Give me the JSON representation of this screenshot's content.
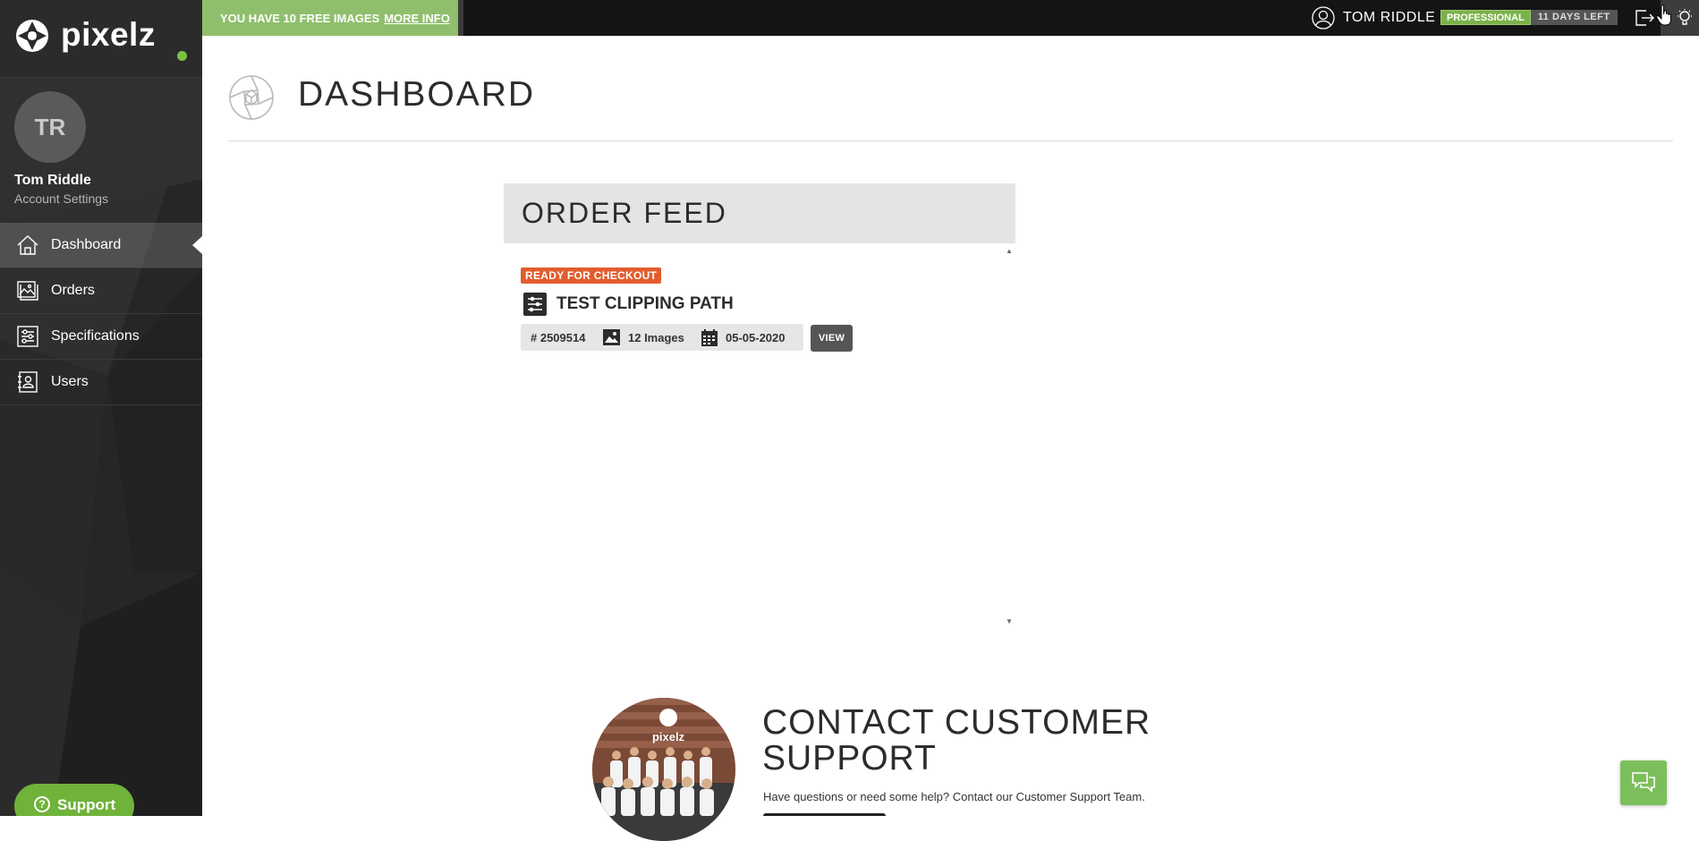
{
  "brand": {
    "name": "pixelz"
  },
  "topbar": {
    "promo_text": "YOU HAVE 10 FREE IMAGES",
    "promo_link": "MORE INFO",
    "user_name": "TOM RIDDLE",
    "plan": "PROFESSIONAL",
    "days_left": "11 DAYS LEFT"
  },
  "sidebar": {
    "avatar_initials": "TR",
    "user_name": "Tom Riddle",
    "account_settings": "Account Settings",
    "items": [
      {
        "label": "Dashboard",
        "icon": "home-icon",
        "active": true
      },
      {
        "label": "Orders",
        "icon": "images-icon"
      },
      {
        "label": "Specifications",
        "icon": "sliders-icon"
      },
      {
        "label": "Users",
        "icon": "contact-book-icon"
      }
    ],
    "support_label": "Support"
  },
  "page": {
    "title": "DASHBOARD"
  },
  "order_feed": {
    "title": "ORDER FEED",
    "orders": [
      {
        "status": "READY FOR CHECKOUT",
        "name": "TEST CLIPPING PATH",
        "number": "# 2509514",
        "images": "12 Images",
        "date": "05-05-2020",
        "view_label": "VIEW"
      }
    ]
  },
  "contact": {
    "title": "CONTACT CUSTOMER SUPPORT",
    "description": "Have questions or need some help? Contact our Customer Support Team.",
    "photo_sign": "pixelz"
  },
  "colors": {
    "accent_green": "#8fbf6c",
    "plan_green": "#7cb24a",
    "status_orange": "#e25c2e",
    "sidebar_bg": "#262626",
    "topbar_bg": "#141414"
  }
}
